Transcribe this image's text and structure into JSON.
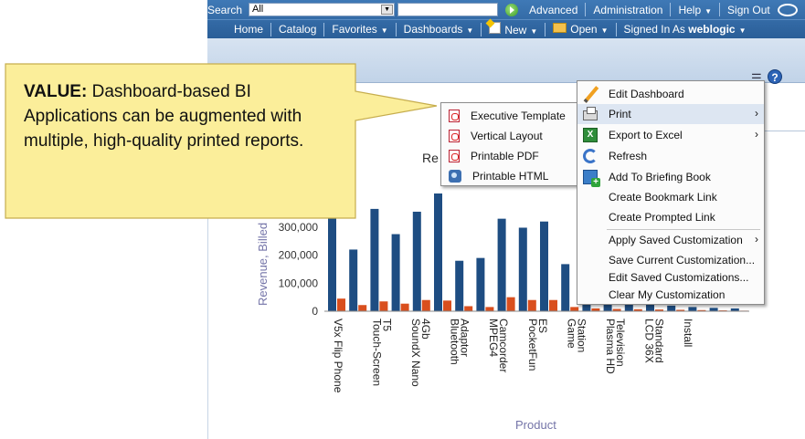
{
  "toolbar": {
    "search_label": "Search",
    "scope_value": "All",
    "advanced": "Advanced",
    "administration": "Administration",
    "help": "Help",
    "sign_out": "Sign Out",
    "home": "Home",
    "catalog": "Catalog",
    "favorites": "Favorites",
    "dashboards": "Dashboards",
    "new": "New",
    "open": "Open",
    "signed_in_as": "Signed In As",
    "username": "weblogic"
  },
  "callout": {
    "lead": "VALUE:",
    "body": " Dashboard-based BI Applications can be augmented with multiple, high-quality printed reports.",
    "fill_color": "#fbee9a",
    "border_color": "#c6ad4d"
  },
  "print_menu": {
    "items": [
      {
        "label": "Executive Template",
        "icon": "pdf-icon"
      },
      {
        "label": "Vertical Layout",
        "icon": "pdf-icon"
      },
      {
        "label": "Printable PDF",
        "icon": "pdf-icon"
      },
      {
        "label": "Printable HTML",
        "icon": "html-icon"
      }
    ]
  },
  "page_menu": {
    "items": [
      {
        "label": "Edit Dashboard",
        "icon": "pencil-icon"
      },
      {
        "label": "Print",
        "icon": "printer-icon",
        "submenu": true,
        "highlighted": true
      },
      {
        "label": "Export to Excel",
        "icon": "excel-icon",
        "submenu": true
      },
      {
        "label": "Refresh",
        "icon": "refresh-icon"
      },
      {
        "label": "Add To Briefing Book",
        "icon": "briefing-book-icon"
      },
      {
        "label": "Create Bookmark Link"
      },
      {
        "label": "Create Prompted Link"
      },
      {
        "label": "Apply Saved Customization",
        "submenu": true
      },
      {
        "label": "Save Current Customization..."
      },
      {
        "label": "Edit Saved Customizations..."
      },
      {
        "label": "Clear My Customization"
      }
    ]
  },
  "chart_data": {
    "type": "bar",
    "title": "Re",
    "ylabel": "Revenue, Billed",
    "xlabel": "Product",
    "ylim": [
      0,
      420000
    ],
    "y_ticks": [
      "0",
      "100,000",
      "200,000",
      "300,000"
    ],
    "categories": [
      "V5x Flip Phone",
      "Touch-Screen T5",
      "SoundX Nano 4Gb",
      "Bluetooth Adaptor",
      "MPEG4 Camcorder",
      "PocketFun ES",
      "Game Station",
      "Plasma HD Television",
      "LCD 36X Standard",
      "Install"
    ],
    "category_lines": [
      [
        "V5x Flip Phone"
      ],
      [
        "Touch-Screen",
        "T5"
      ],
      [
        "SoundX Nano",
        "4Gb"
      ],
      [
        "Bluetooth",
        "Adaptor"
      ],
      [
        "MPEG4",
        "Camcorder"
      ],
      [
        "PocketFun",
        "ES"
      ],
      [
        "Game",
        "Station"
      ],
      [
        "Plasma HD",
        "Television"
      ],
      [
        "LCD 36X",
        "Standard"
      ],
      [
        "Install"
      ]
    ],
    "series_colors": [
      "#1e4d82",
      "#d94f1e"
    ],
    "series": [
      {
        "values": [
          360000,
          220000,
          365000,
          275000,
          355000,
          420000,
          180000,
          190000,
          330000,
          298000,
          320000,
          168000,
          60000,
          40000,
          30000,
          25000,
          20000,
          15000,
          12000,
          10000
        ]
      },
      {
        "values": [
          45000,
          22000,
          35000,
          27000,
          40000,
          38000,
          18000,
          15000,
          50000,
          40000,
          40000,
          15000,
          10000,
          8000,
          7000,
          6000,
          5000,
          4000,
          3000,
          2000
        ]
      }
    ]
  }
}
